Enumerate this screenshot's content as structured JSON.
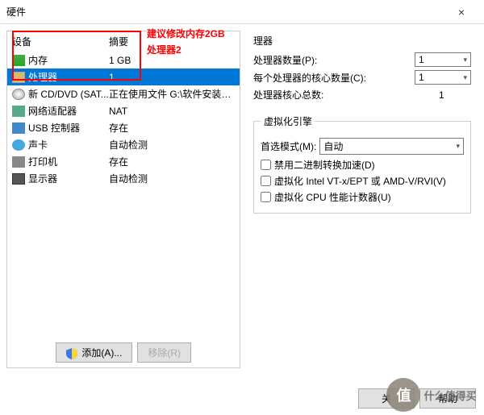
{
  "window": {
    "title": "硬件",
    "close": "×"
  },
  "headers": {
    "device": "设备",
    "summary": "摘要"
  },
  "devices": [
    {
      "name": "内存",
      "summary": "1 GB",
      "icon": "ico-mem"
    },
    {
      "name": "处理器",
      "summary": "1",
      "icon": "ico-cpu",
      "selected": true
    },
    {
      "name": "新 CD/DVD (SAT...",
      "summary": "正在使用文件 G:\\软件安装包\\系统文...",
      "icon": "ico-cd"
    },
    {
      "name": "网络适配器",
      "summary": "NAT",
      "icon": "ico-net"
    },
    {
      "name": "USB 控制器",
      "summary": "存在",
      "icon": "ico-usb"
    },
    {
      "name": "声卡",
      "summary": "自动检测",
      "icon": "ico-sound"
    },
    {
      "name": "打印机",
      "summary": "存在",
      "icon": "ico-print"
    },
    {
      "name": "显示器",
      "summary": "自动检测",
      "icon": "ico-disp"
    }
  ],
  "buttons": {
    "add": "添加(A)...",
    "remove": "移除(R)"
  },
  "right": {
    "group": "理器",
    "procCount": {
      "label": "处理器数量(P):",
      "value": "1"
    },
    "coresPer": {
      "label": "每个处理器的核心数量(C):",
      "value": "1"
    },
    "totalCores": {
      "label": "处理器核心总数:",
      "value": "1"
    }
  },
  "virt": {
    "legend": "虚拟化引擎",
    "mode": {
      "label": "首选模式(M):",
      "value": "自动"
    },
    "cb1": "禁用二进制转换加速(D)",
    "cb2": "虚拟化 Intel VT-x/EPT 或 AMD-V/RVI(V)",
    "cb3": "虚拟化 CPU 性能计数器(U)"
  },
  "annotation": {
    "line1": "建议修改内存2GB",
    "line2": "处理器2"
  },
  "footer": {
    "close": "关",
    "help": "帮助"
  },
  "watermark": {
    "char": "值",
    "text": "什么值得买"
  }
}
